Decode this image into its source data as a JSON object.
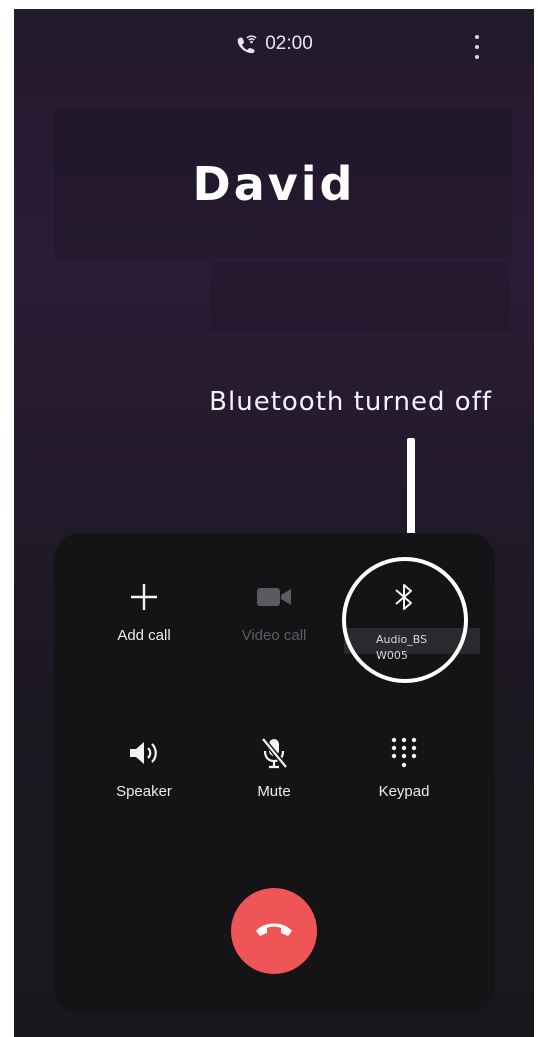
{
  "status": {
    "call_timer": "02:00"
  },
  "caller": {
    "name": "David"
  },
  "annotation": {
    "text": "Bluetooth turned off"
  },
  "controls": {
    "add_call": "Add call",
    "video_call": "Video call",
    "bluetooth_line1": "Audio_BS",
    "bluetooth_line2": "W005",
    "speaker": "Speaker",
    "mute": "Mute",
    "keypad": "Keypad"
  },
  "colors": {
    "end_call": "#ef5456",
    "panel": "#141417",
    "disabled_text": "#5c5c62"
  }
}
